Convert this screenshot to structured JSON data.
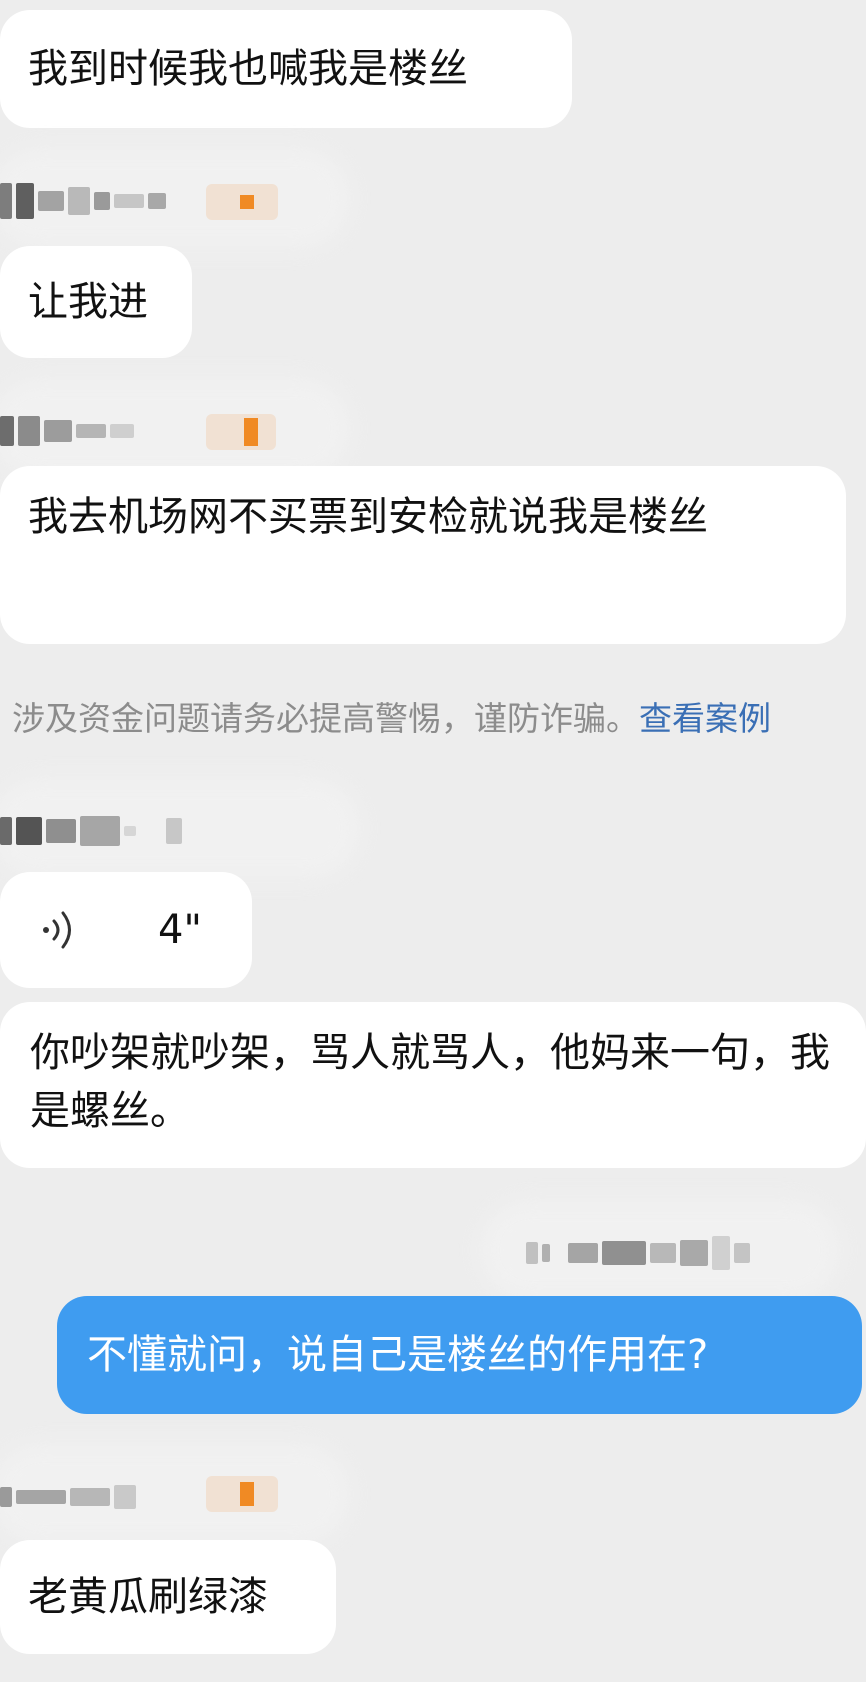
{
  "messages": [
    {
      "text": "我到时候我也喊我是楼丝"
    },
    {
      "text": "让我进"
    },
    {
      "text": "我去机场网不买票到安检就说我是楼丝"
    },
    {
      "voice_duration": "4\""
    },
    {
      "text": "你吵架就吵架，骂人就骂人，他妈来一句，我是螺丝。"
    },
    {
      "text": "不懂就问，说自己是楼丝的作用在?",
      "outgoing": true
    },
    {
      "text": "老黄瓜刷绿漆"
    }
  ],
  "notice": {
    "text": "涉及资金问题请务必提高警惕，谨防诈骗。",
    "link": "查看案例"
  },
  "colors": {
    "background": "#ededed",
    "incoming_bubble": "#ffffff",
    "outgoing_bubble": "#3f9cf0",
    "link": "#3a6fb5",
    "tag_dot": "#f08a24"
  },
  "icons": {
    "voice": "voice-wave-icon"
  }
}
